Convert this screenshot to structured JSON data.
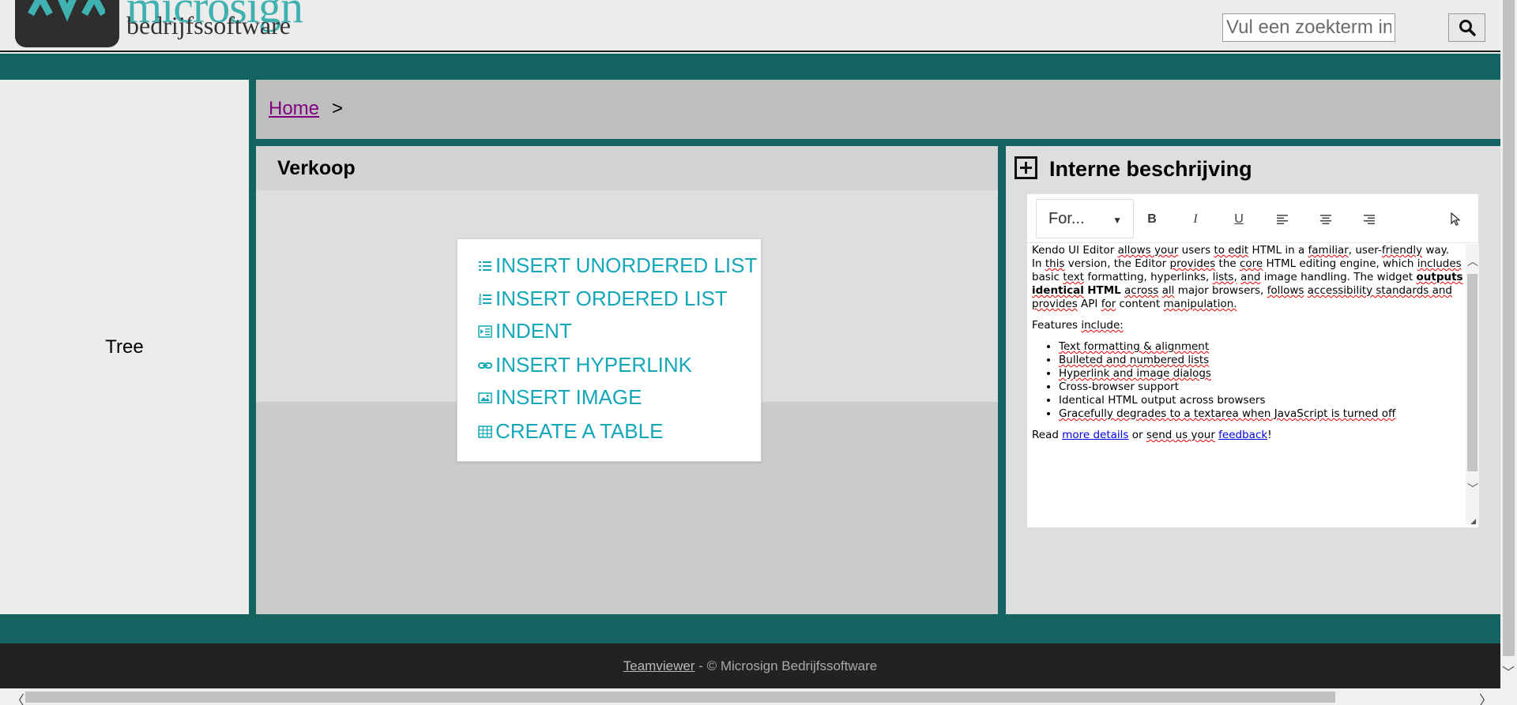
{
  "header": {
    "logo_word": "microsign",
    "logo_sub": "bedrijfssoftware",
    "search_placeholder": "Vul een zoekterm in",
    "search_icon": "search-icon"
  },
  "tree": {
    "label": "Tree"
  },
  "breadcrumb": {
    "home": "Home",
    "separator": ">"
  },
  "verkoop": {
    "title": "Verkoop"
  },
  "insert_menu": {
    "items": [
      {
        "label": "INSERT UNORDERED LIST",
        "icon": "unordered-list-icon"
      },
      {
        "label": "INSERT ORDERED LIST",
        "icon": "ordered-list-icon"
      },
      {
        "label": "INDENT",
        "icon": "indent-icon"
      },
      {
        "label": "INSERT HYPERLINK",
        "icon": "hyperlink-icon"
      },
      {
        "label": "INSERT IMAGE",
        "icon": "image-icon"
      },
      {
        "label": "CREATE A TABLE",
        "icon": "table-icon"
      }
    ]
  },
  "interne": {
    "title": "Interne beschrijving",
    "expand_icon": "plus-box-icon"
  },
  "editor": {
    "format_label": "For...",
    "toolbar": {
      "bold": "B",
      "italic": "I",
      "underline": "U"
    },
    "content": {
      "p1_a": "Kendo UI Editor",
      "p1_b": "allows your",
      "p1_c": "users",
      "p1_d": "to edit",
      "p1_e": "HTML in a",
      "p1_f": "familiar",
      "p1_g": ", user-",
      "p1_h": "friendly",
      "p1_i": " way.",
      "p2_a": "In",
      "p2_b": "this",
      "p2_c": "version, the Editor",
      "p2_d": "provides",
      "p2_e": "the",
      "p2_f": "core",
      "p2_g": "HTML editing engine, which",
      "p2_h": "includes",
      "p2_i": "basic",
      "p2_j": "text",
      "p2_k": "formatting,",
      "p2_l": "hyperlinks,",
      "p2_m": "lists,",
      "p2_n": "and",
      "p2_o": "image handling. The widget",
      "p2_p": "outputs identical",
      "p2_q": "HTML",
      "p2_r": "across",
      "p2_s": "all",
      "p2_t": "major browsers,",
      "p2_u": "follows",
      "p2_v": "accessibility standards and provides",
      "p2_w": "API",
      "p2_x": "for",
      "p2_y": "content",
      "p2_z": "manipulation.",
      "features_a": "Features",
      "features_b": "include:",
      "list": [
        "Text formatting & alignment",
        "Bulleted and numbered lists",
        "Hyperlink and image dialogs",
        "Cross-browser support",
        "Identical HTML output across browsers",
        "Gracefully degrades to a textarea when JavaScript is turned off"
      ],
      "read_a": "Read",
      "read_link1": "more details",
      "read_b": "or",
      "read_c": "send us your",
      "read_link2": "feedback",
      "read_d": "!"
    }
  },
  "footer": {
    "link": "Teamviewer",
    "text": " - © Microsign Bedrijfssoftware"
  },
  "colors": {
    "teal_bar": "#136360",
    "logo_teal": "#3fb1b0",
    "menu_text": "#13a7b9",
    "footer_bg": "#222222"
  }
}
